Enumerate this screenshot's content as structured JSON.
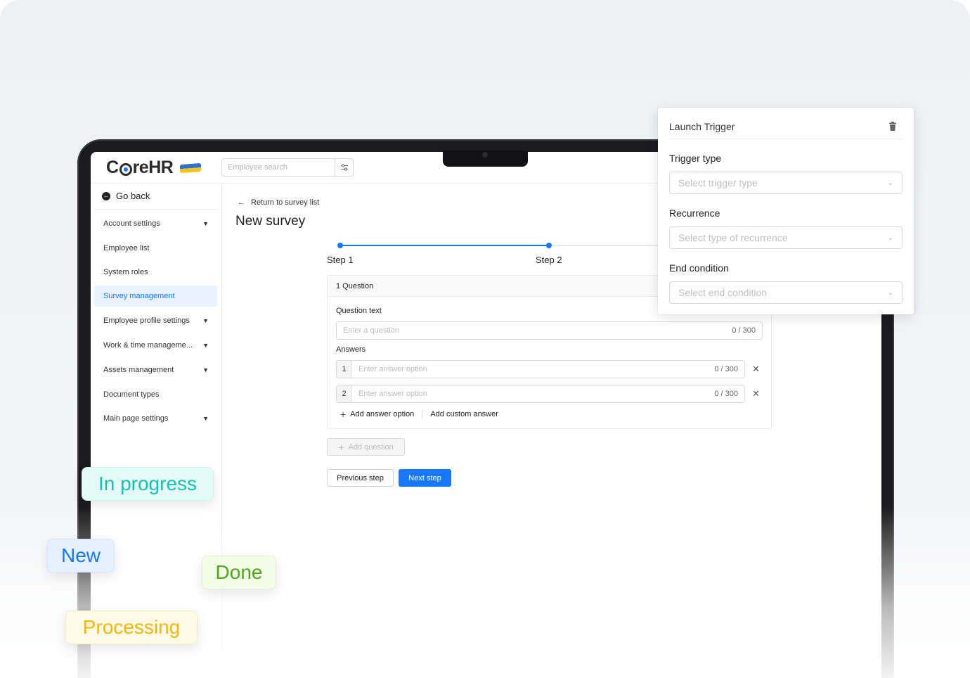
{
  "app": {
    "logo_text_pre": "C",
    "logo_text_post": "reHR"
  },
  "header": {
    "search_placeholder": "Employee search"
  },
  "sidebar": {
    "go_back": "Go back",
    "items": [
      {
        "label": "Account settings",
        "expandable": true,
        "active": false
      },
      {
        "label": "Employee list",
        "expandable": false,
        "active": false
      },
      {
        "label": "System roles",
        "expandable": false,
        "active": false
      },
      {
        "label": "Survey management",
        "expandable": false,
        "active": true
      },
      {
        "label": "Employee profile settings",
        "expandable": true,
        "active": false
      },
      {
        "label": "Work & time manageme...",
        "expandable": true,
        "active": false
      },
      {
        "label": "Assets management",
        "expandable": true,
        "active": false
      },
      {
        "label": "Document types",
        "expandable": false,
        "active": false
      },
      {
        "label": "Main page settings",
        "expandable": true,
        "active": false
      }
    ]
  },
  "main": {
    "return_link": "Return to survey list",
    "title": "New survey",
    "steps": [
      {
        "label": "Step 1"
      },
      {
        "label": "Step 2"
      }
    ],
    "question_card": {
      "header": "1 Question",
      "question_label": "Question text",
      "question_placeholder": "Enter a question",
      "question_count": "0 / 300",
      "answers_label": "Answers",
      "answers": [
        {
          "num": "1",
          "placeholder": "Enter answer option",
          "count": "0 / 300"
        },
        {
          "num": "2",
          "placeholder": "Enter answer option",
          "count": "0 / 300"
        }
      ],
      "add_answer_option": "Add answer option",
      "add_custom_answer": "Add custom answer"
    },
    "add_question": "Add question",
    "previous_step": "Previous step",
    "next_step": "Next step"
  },
  "popover": {
    "title": "Launch Trigger",
    "trigger_type_label": "Trigger type",
    "trigger_type_placeholder": "Select trigger type",
    "recurrence_label": "Recurrence",
    "recurrence_placeholder": "Select type of recurrence",
    "end_condition_label": "End condition",
    "end_condition_placeholder": "Select end condition"
  },
  "badges": {
    "in_progress": "In progress",
    "new": "New",
    "done": "Done",
    "processing": "Processing"
  },
  "colors": {
    "primary": "#1677ff",
    "in_progress": "#14c2b3",
    "done": "#52a61b",
    "processing": "#f5b50a",
    "active_bg": "#e8f3ff"
  }
}
